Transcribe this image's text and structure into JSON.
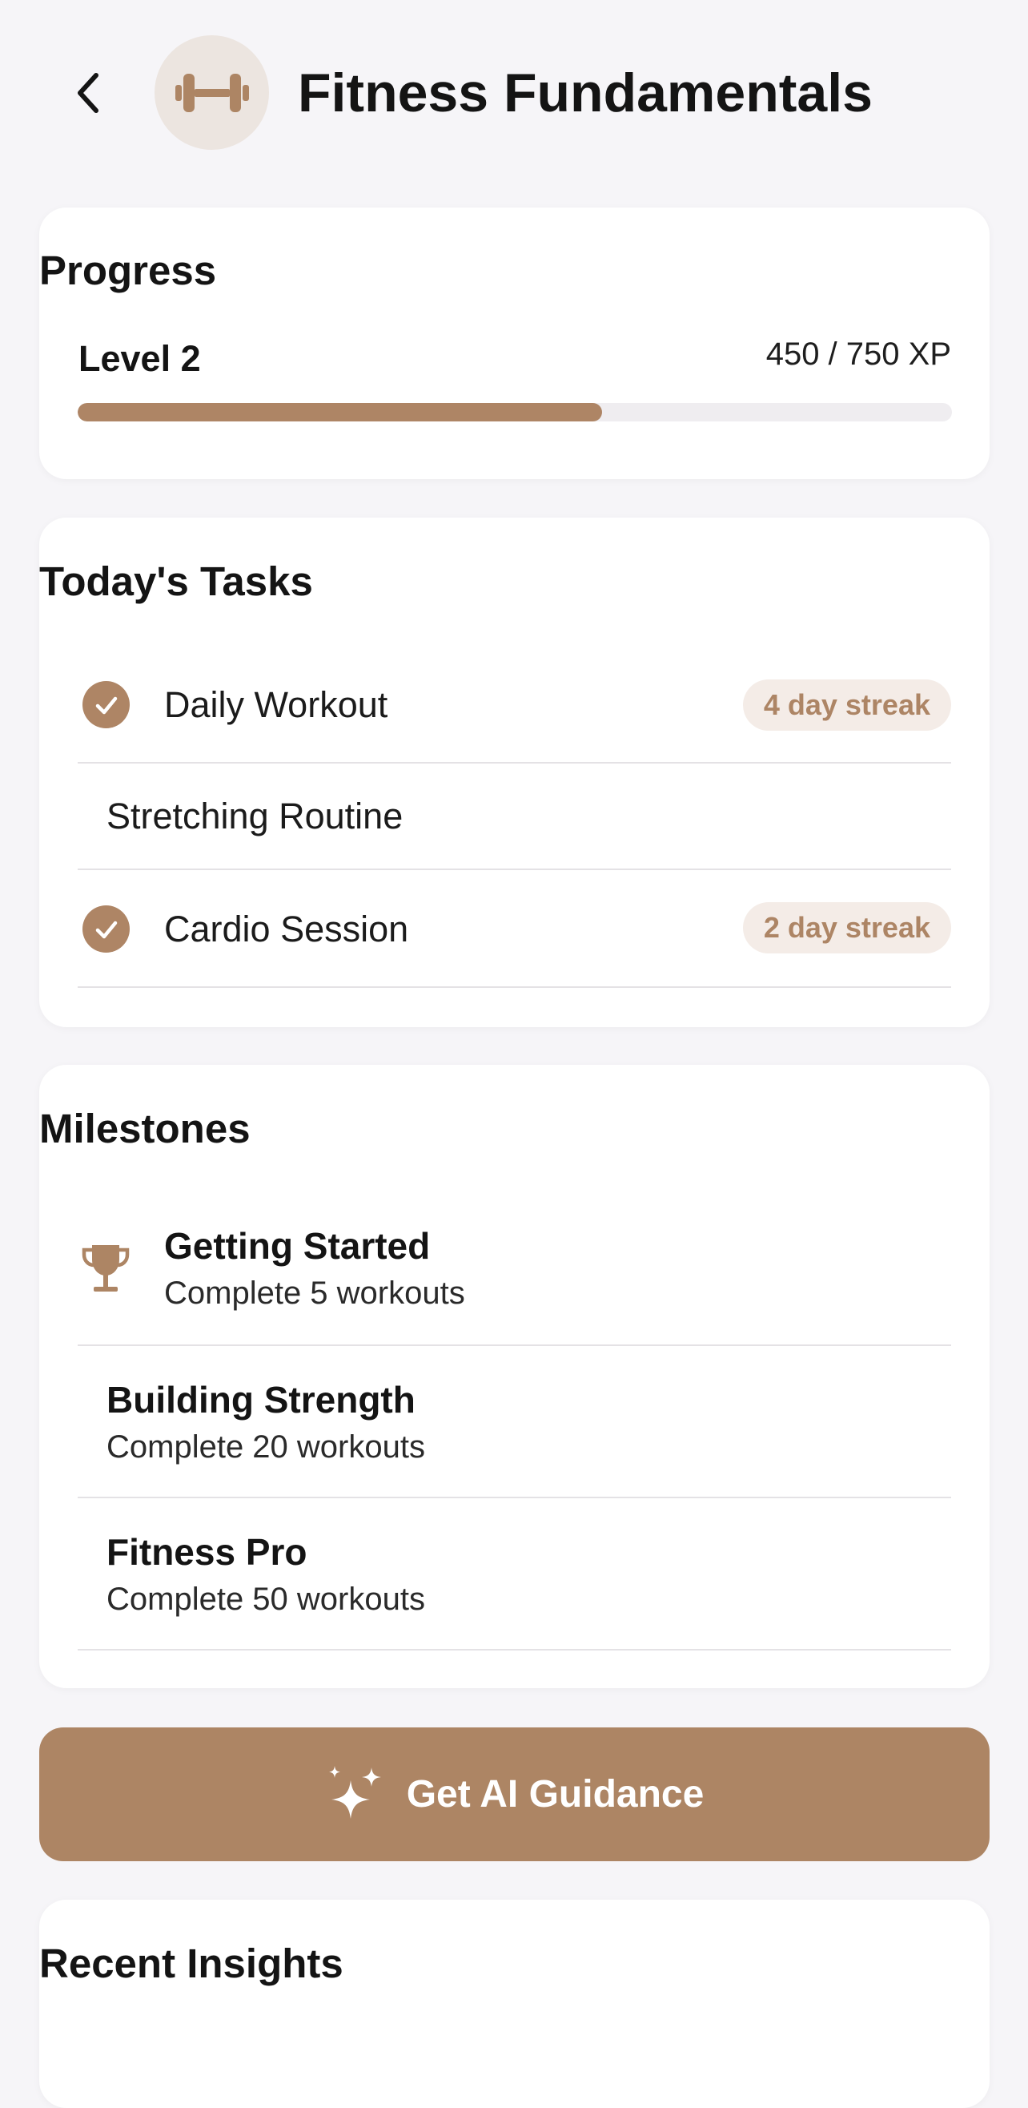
{
  "header": {
    "title": "Fitness Fundamentals",
    "back_icon": "chevron-left-icon",
    "avatar_icon": "dumbbell-icon"
  },
  "progress": {
    "heading": "Progress",
    "level": "Level 2",
    "xp_text": "450 / 750 XP",
    "fraction": 0.6
  },
  "tasks": {
    "heading": "Today's Tasks",
    "items": [
      {
        "label": "Daily Workout",
        "completed": true,
        "streak": "4 day streak"
      },
      {
        "label": "Stretching Routine",
        "completed": false,
        "streak": ""
      },
      {
        "label": "Cardio Session",
        "completed": true,
        "streak": "2 day streak"
      }
    ]
  },
  "milestones": {
    "heading": "Milestones",
    "items": [
      {
        "title": "Getting Started",
        "subtitle": "Complete 5 workouts",
        "achieved": true,
        "icon": "trophy-icon"
      },
      {
        "title": "Building Strength",
        "subtitle": "Complete 20 workouts",
        "achieved": false
      },
      {
        "title": "Fitness Pro",
        "subtitle": "Complete 50 workouts",
        "achieved": false
      }
    ]
  },
  "guidance": {
    "label": "Get AI Guidance",
    "icon": "sparkles-icon"
  },
  "insights": {
    "heading": "Recent Insights"
  },
  "colors": {
    "accent": "#ad8564",
    "badge_bg": "#f4ece7",
    "avatar_bg": "#ece5e0",
    "page_bg": "#f6f5f8"
  }
}
